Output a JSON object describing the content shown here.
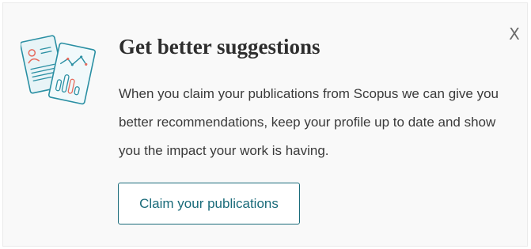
{
  "card": {
    "title": "Get better suggestions",
    "description": "When you claim your publications from Scopus we can give you better recommendations, keep your profile up to date and show you the impact your work is having.",
    "cta_label": "Claim your publications",
    "close_label": "X",
    "icons": {
      "illustration": "documents-illustration-icon",
      "close": "close-icon"
    }
  },
  "colors": {
    "accent": "#1a6b7a",
    "illustration_teal": "#2a8fa3",
    "illustration_coral": "#e66a5c",
    "background": "#f9f9f9"
  }
}
